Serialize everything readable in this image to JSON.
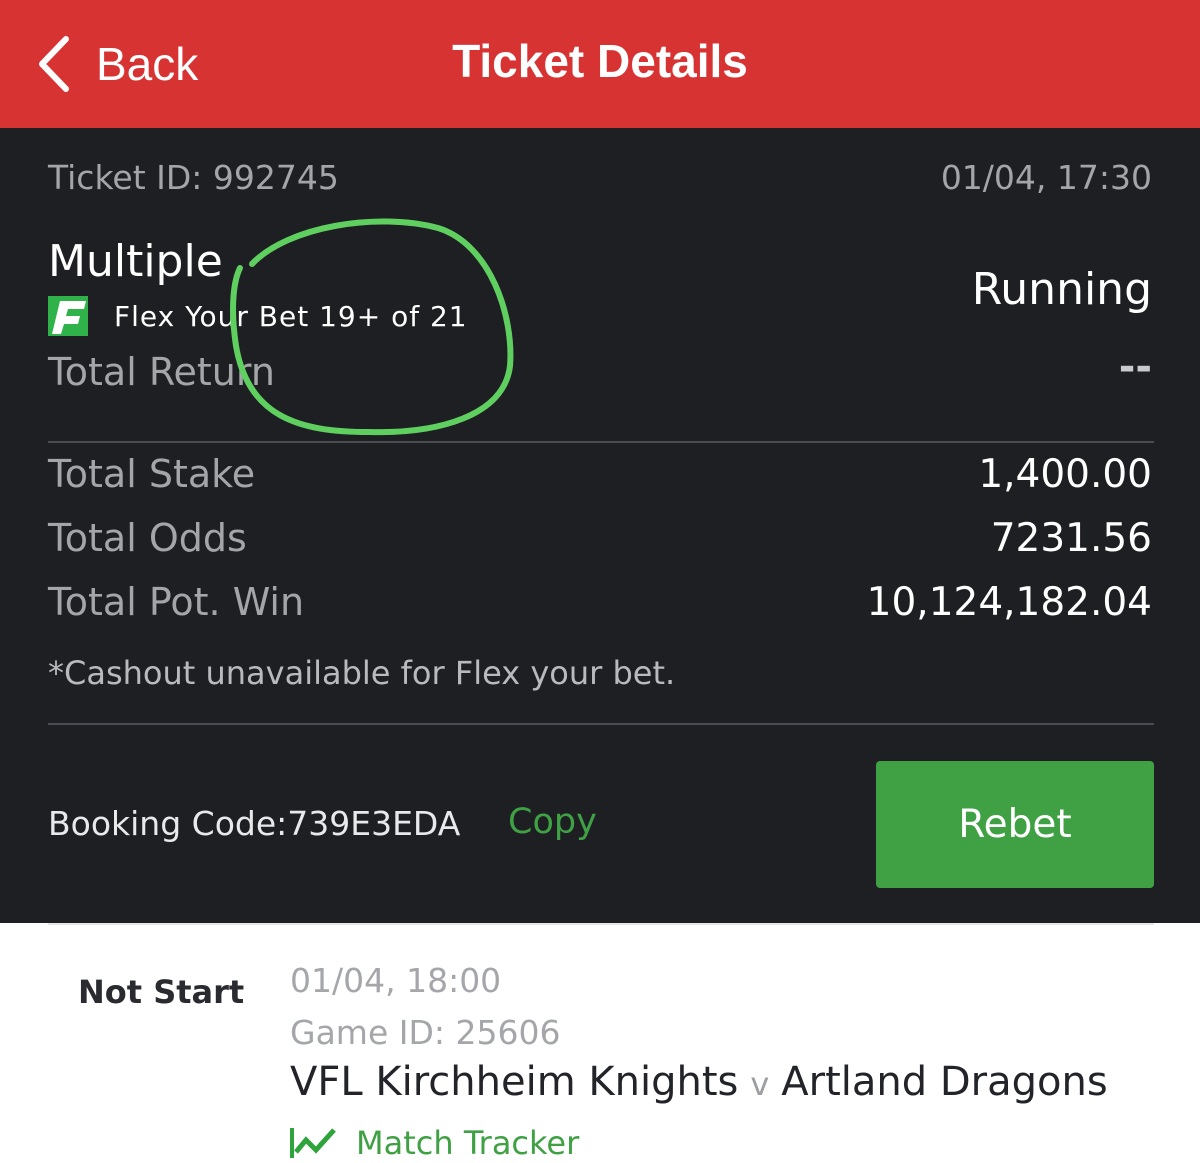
{
  "header": {
    "back_label": "Back",
    "title": "Ticket Details"
  },
  "ticket": {
    "id_text": "Ticket ID: 992745",
    "datetime": "01/04, 17:30",
    "bet_type": "Multiple",
    "flex_label": "Flex Your Bet 19+ of 21",
    "status": "Running",
    "total_return_label": "Total Return",
    "total_return_value": "--",
    "total_stake_label": "Total Stake",
    "total_stake_value": "1,400.00",
    "total_odds_label": "Total Odds",
    "total_odds_value": "7231.56",
    "total_pot_win_label": "Total Pot. Win",
    "total_pot_win_value": "10,124,182.04",
    "cashout_note": "*Cashout unavailable for Flex your bet.",
    "booking_code_text": "Booking Code:739E3EDA",
    "copy_label": "Copy",
    "rebet_label": "Rebet"
  },
  "match": {
    "status": "Not Start",
    "datetime": "01/04, 18:00",
    "game_id_text": "Game ID: 25606",
    "home_team": "VFL Kirchheim Knights",
    "versus": "v",
    "away_team": "Artland Dragons",
    "tracker_label": "Match Tracker"
  },
  "colors": {
    "header_bg": "#d73333",
    "panel_bg": "#1e1f23",
    "accent_green": "#3fa144",
    "annotation_green": "#5fcf5f"
  },
  "icons": {
    "back": "chevron-left-icon",
    "flex": "flex-f-logo-icon",
    "tracker": "match-tracker-icon"
  }
}
